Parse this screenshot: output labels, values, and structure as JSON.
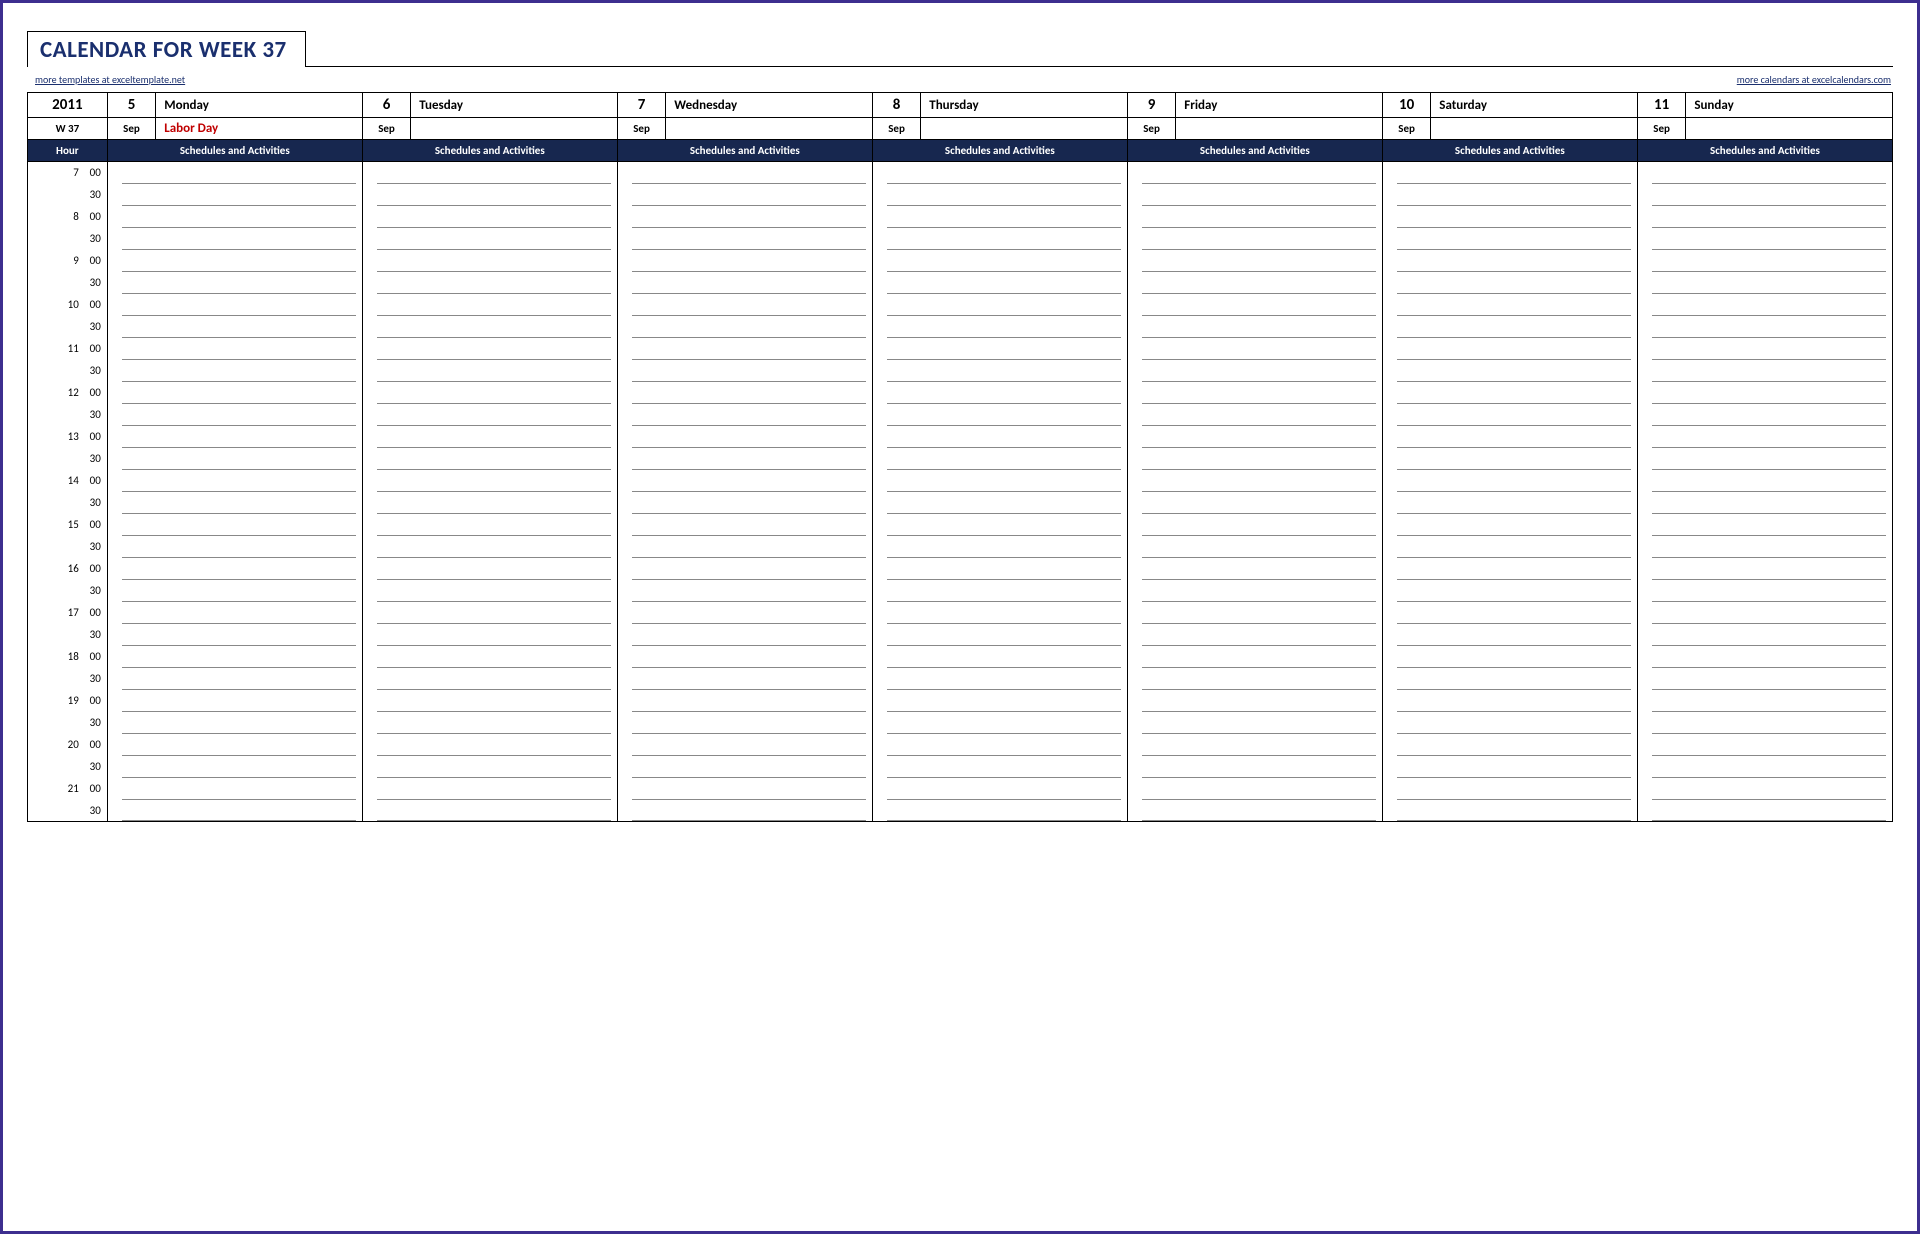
{
  "title": "CALENDAR FOR WEEK 37",
  "link_left": "more templates at exceltemplate.net",
  "link_right": "more calendars at excelcalendars.com",
  "year": "2011",
  "week": "W 37",
  "hour_header": "Hour",
  "activities_header": "Schedules and Activities",
  "days": [
    {
      "num": "5",
      "name": "Monday",
      "month": "Sep",
      "holiday": "Labor Day"
    },
    {
      "num": "6",
      "name": "Tuesday",
      "month": "Sep",
      "holiday": ""
    },
    {
      "num": "7",
      "name": "Wednesday",
      "month": "Sep",
      "holiday": ""
    },
    {
      "num": "8",
      "name": "Thursday",
      "month": "Sep",
      "holiday": ""
    },
    {
      "num": "9",
      "name": "Friday",
      "month": "Sep",
      "holiday": ""
    },
    {
      "num": "10",
      "name": "Saturday",
      "month": "Sep",
      "holiday": ""
    },
    {
      "num": "11",
      "name": "Sunday",
      "month": "Sep",
      "holiday": ""
    }
  ],
  "hours": [
    7,
    8,
    9,
    10,
    11,
    12,
    13,
    14,
    15,
    16,
    17,
    18,
    19,
    20,
    21
  ],
  "halves": [
    "00",
    "30"
  ]
}
